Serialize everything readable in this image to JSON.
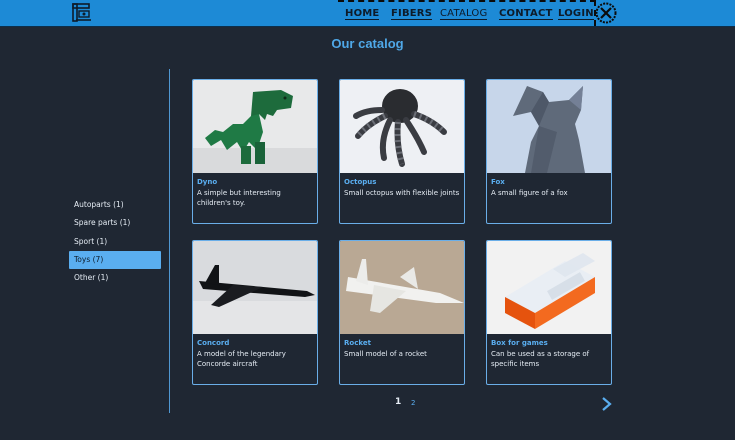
{
  "header": {
    "nav": [
      {
        "label": "HOME"
      },
      {
        "label": "FIBERS"
      },
      {
        "label": "CATALOG"
      },
      {
        "label": "CONTACT"
      },
      {
        "label": "LOGIN"
      }
    ],
    "active_nav": "CATALOG",
    "accent_color": "#1d8ad6"
  },
  "page": {
    "title": "Our catalog"
  },
  "sidebar": {
    "categories": [
      {
        "label": "Autoparts (1)"
      },
      {
        "label": "Spare parts (1)"
      },
      {
        "label": "Sport (1)"
      },
      {
        "label": "Toys (7)"
      },
      {
        "label": "Other (1)"
      }
    ],
    "active_category": "Toys (7)"
  },
  "products": [
    {
      "name": "Dyno",
      "description": "A simple but interesting children's toy.",
      "image": "green-dinosaur-toy"
    },
    {
      "name": "Octopus",
      "description": "Small octopus with flexible joints",
      "image": "black-octopus-toy"
    },
    {
      "name": "Fox",
      "description": "A small figure of a fox",
      "image": "grey-low-poly-fox"
    },
    {
      "name": "Concord",
      "description": "A model of the legendary Concorde aircraft",
      "image": "black-concorde-model"
    },
    {
      "name": "Rocket",
      "description": "Small model of a rocket",
      "image": "white-rocket-plane"
    },
    {
      "name": "Box for games",
      "description": "Can be used as a storage of specific items",
      "image": "orange-storage-box"
    }
  ],
  "pagination": {
    "current": "1",
    "other": "2",
    "next_icon": "chevron-right-icon"
  }
}
